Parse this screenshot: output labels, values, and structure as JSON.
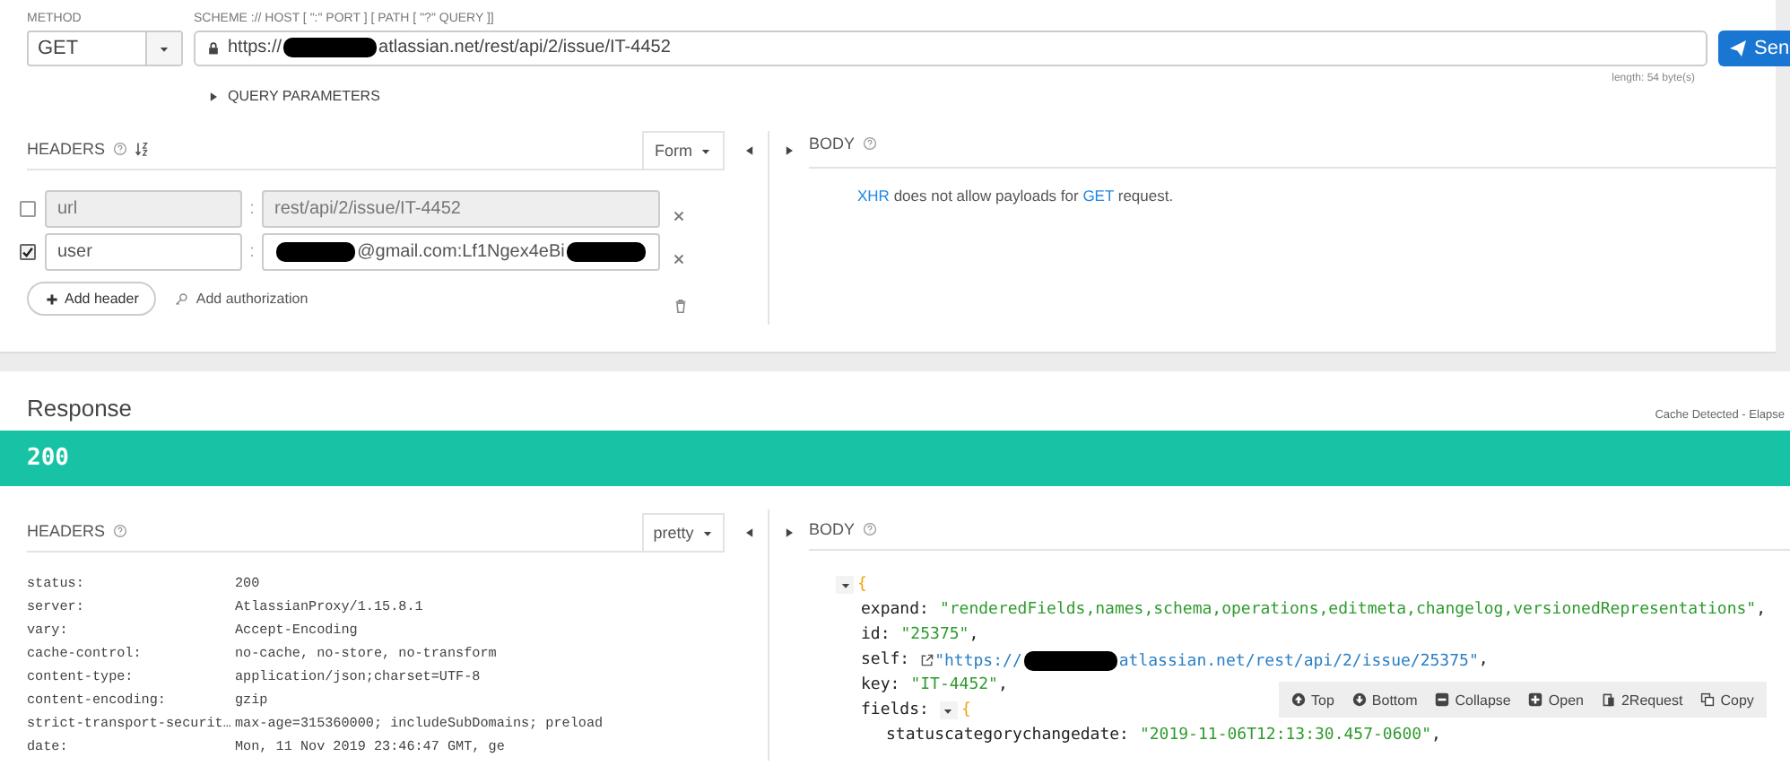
{
  "request": {
    "method_label": "METHOD",
    "method": "GET",
    "url_label": "SCHEME :// HOST [ \":\" PORT ] [ PATH [ \"?\" QUERY ]]",
    "url": [
      {
        "kind": "text",
        "text": "https://"
      },
      {
        "kind": "redacted"
      },
      {
        "kind": "text",
        "text": "atlassian.net/rest/api/2/issue/IT-4452"
      }
    ],
    "send": "Sen",
    "length": "length: 54 byte(s)",
    "query_parameters": "QUERY PARAMETERS",
    "query_expanded": false
  },
  "request_headers": {
    "title": "HEADERS",
    "mode": "Form",
    "rows": [
      {
        "checked": false,
        "name": "url",
        "separator": ":",
        "value": [
          {
            "kind": "text",
            "text": "rest/api/2/issue/IT-4452"
          }
        ]
      },
      {
        "checked": true,
        "name": "user",
        "separator": ":",
        "value": [
          {
            "kind": "redacted"
          },
          {
            "kind": "text",
            "text": "@gmail.com:Lf1Ngex4eBi"
          },
          {
            "kind": "redacted"
          }
        ]
      }
    ],
    "add_header": "Add header",
    "add_authorization": "Add authorization"
  },
  "request_body": {
    "title": "BODY",
    "message": [
      {
        "kind": "link",
        "text": "XHR"
      },
      {
        "kind": "text",
        "text": " does not allow payloads for "
      },
      {
        "kind": "link",
        "text": "GET"
      },
      {
        "kind": "text",
        "text": " request."
      }
    ]
  },
  "response": {
    "title": "Response",
    "cache_note": "Cache Detected - Elapse",
    "status": "200",
    "headers_title": "HEADERS",
    "view_mode": "pretty",
    "headers": [
      {
        "name": "status:",
        "value": "200"
      },
      {
        "name": "server:",
        "value": "AtlassianProxy/1.15.8.1"
      },
      {
        "name": "vary:",
        "value": "Accept-Encoding"
      },
      {
        "name": "cache-control:",
        "value": "no-cache, no-store, no-transform"
      },
      {
        "name": "content-type:",
        "value": "application/json;charset=UTF-8"
      },
      {
        "name": "content-encoding:",
        "value": "gzip"
      },
      {
        "name": "strict-transport-securit…",
        "value": "max-age=315360000; includeSubDomains; preload"
      },
      {
        "name": "date:",
        "value": "Mon, 11 Nov 2019 23:46:47 GMT, ge"
      }
    ],
    "body_title": "BODY",
    "json": {
      "expanded": true,
      "brace": "{",
      "entries": [
        {
          "key": "expand:",
          "kind": "string",
          "value": [
            {
              "kind": "text",
              "text": "\"renderedFields,names,schema,operations,editmeta,changelog,versionedRepresentations\""
            }
          ],
          "comma": ","
        },
        {
          "key": "id:",
          "kind": "string",
          "value": [
            {
              "kind": "text",
              "text": "\"25375\""
            }
          ],
          "comma": ","
        },
        {
          "key": "self:",
          "kind": "link",
          "value": [
            {
              "kind": "text",
              "text": "\"https://"
            },
            {
              "kind": "redacted"
            },
            {
              "kind": "text",
              "text": "atlassian.net/rest/api/2/issue/25375\""
            }
          ],
          "comma": ","
        },
        {
          "key": "key:",
          "kind": "string",
          "value": [
            {
              "kind": "text",
              "text": "\"IT-4452\""
            }
          ],
          "comma": ","
        },
        {
          "key": "fields:",
          "kind": "object",
          "expanded": true,
          "brace": "{",
          "children": [
            {
              "key": "statuscategorychangedate:",
              "kind": "string",
              "value": [
                {
                  "kind": "text",
                  "text": "\"2019-11-06T12:13:30.457-0600\""
                }
              ],
              "comma": ","
            }
          ]
        }
      ]
    },
    "toolbar": [
      {
        "label": "Top"
      },
      {
        "label": "Bottom"
      },
      {
        "label": "Collapse"
      },
      {
        "label": "Open"
      },
      {
        "label": "2Request"
      },
      {
        "label": "Copy"
      }
    ]
  }
}
